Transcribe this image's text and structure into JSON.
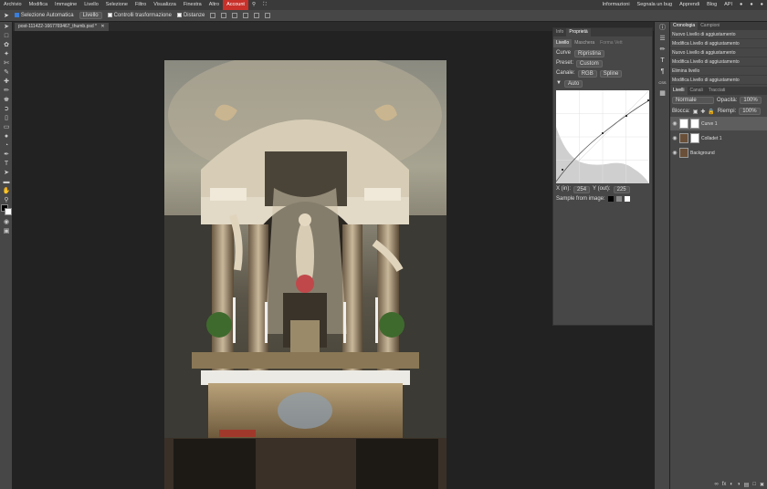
{
  "menu": {
    "left": [
      "Archivio",
      "Modifica",
      "Immagine",
      "Livello",
      "Selezione",
      "Filtro",
      "Visualizza",
      "Finestra",
      "Altro",
      "Account"
    ],
    "right": [
      "Informazioni",
      "Segnala un bug",
      "Apprendi",
      "Blog",
      "API"
    ]
  },
  "options": {
    "auto_select_label": "Selezione Automatica",
    "auto_select_value": "Livello",
    "transform_label": "Controlli trasformazione",
    "distances_label": "Distanze"
  },
  "document": {
    "tab_title": "post-111422-1667769467_thumb.psd *"
  },
  "properties": {
    "tabs": [
      "Info",
      "Proprietà"
    ],
    "subtabs": [
      "Livello",
      "Maschera",
      "Forma Vett"
    ],
    "curve_label": "Curve",
    "reset_label": "Ripristina",
    "preset_label": "Preset:",
    "preset_value": "Custom",
    "channel_label": "Canale:",
    "channel_value": "RGB",
    "spline_value": "Spline",
    "auto_label": "Auto",
    "x_in_label": "X (in):",
    "x_in_value": "254",
    "y_out_label": "Y (out):",
    "y_out_value": "225",
    "sample_label": "Sample from image:"
  },
  "history": {
    "tabs": [
      "Cronologia",
      "Campioni"
    ],
    "items": [
      "Nuovo Livello di aggiustamento",
      "Modifica Livello di aggiustamento",
      "Nuovo Livello di aggiustamento",
      "Modifica Livello di aggiustamento",
      "Elimina livello",
      "Modifica Livello di aggiustamento"
    ]
  },
  "layers": {
    "tabs": [
      "Livelli",
      "Canali",
      "Tracciati"
    ],
    "blend_mode": "Normale",
    "opacity_label": "Opacità:",
    "opacity_value": "100%",
    "lock_label": "Blocca:",
    "fill_label": "Riempi:",
    "fill_value": "100%",
    "items": [
      "Curve 1",
      "Colladet 1",
      "Background"
    ]
  },
  "colors": {
    "accent": "#c8302a",
    "selection": "#3b7dd8"
  }
}
